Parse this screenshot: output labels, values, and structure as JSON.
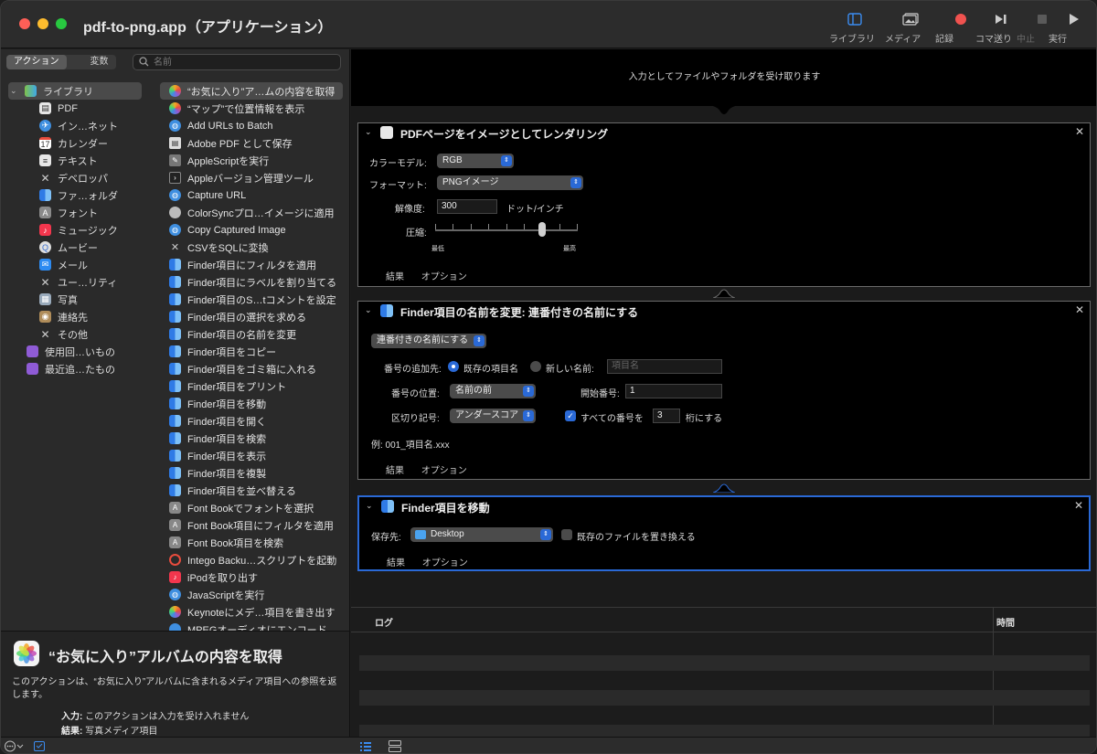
{
  "window": {
    "title": "pdf-to-png.app（アプリケーション）"
  },
  "toolbar": {
    "library": "ライブラリ",
    "media": "メディア",
    "record": "記録",
    "step": "コマ送り",
    "stop": "中止",
    "run": "実行"
  },
  "leftpane": {
    "tab_actions": "アクション",
    "tab_variables": "変数",
    "search_placeholder": "名前"
  },
  "categories": [
    {
      "label": "ライブラリ",
      "icon": "library-icon"
    },
    {
      "label": "PDF",
      "icon": "pdf-icon"
    },
    {
      "label": "イン…ネット",
      "icon": "internet-icon"
    },
    {
      "label": "カレンダー",
      "icon": "calendar-icon"
    },
    {
      "label": "テキスト",
      "icon": "text-icon"
    },
    {
      "label": "デベロッパ",
      "icon": "developer-icon"
    },
    {
      "label": "ファ…ォルダ",
      "icon": "finder-icon"
    },
    {
      "label": "フォント",
      "icon": "font-icon"
    },
    {
      "label": "ミュージック",
      "icon": "music-icon"
    },
    {
      "label": "ムービー",
      "icon": "movie-icon"
    },
    {
      "label": "メール",
      "icon": "mail-icon"
    },
    {
      "label": "ユー…リティ",
      "icon": "utility-icon"
    },
    {
      "label": "写真",
      "icon": "photos-icon"
    },
    {
      "label": "連絡先",
      "icon": "contacts-icon"
    },
    {
      "label": "その他",
      "icon": "other-icon"
    },
    {
      "label": "使用回…いもの",
      "icon": "smart-folder-icon"
    },
    {
      "label": "最近追…たもの",
      "icon": "smart-folder-icon"
    }
  ],
  "actions": [
    "“お気に入り”ア…ムの内容を取得",
    "“マップ”で位置情報を表示",
    "Add URLs to Batch",
    "Adobe PDF として保存",
    "AppleScriptを実行",
    "Appleバージョン管理ツール",
    "Capture URL",
    "ColorSyncプロ…イメージに適用",
    "Copy Captured Image",
    "CSVをSQLに変換",
    "Finder項目にフィルタを適用",
    "Finder項目にラベルを割り当てる",
    "Finder項目のS…tコメントを設定",
    "Finder項目の選択を求める",
    "Finder項目の名前を変更",
    "Finder項目をコピー",
    "Finder項目をゴミ箱に入れる",
    "Finder項目をプリント",
    "Finder項目を移動",
    "Finder項目を開く",
    "Finder項目を検索",
    "Finder項目を表示",
    "Finder項目を複製",
    "Finder項目を並べ替える",
    "Font Bookでフォントを選択",
    "Font Book項目にフィルタを適用",
    "Font Book項目を検索",
    "Intego Backu…スクリプトを起動",
    "iPodを取り出す",
    "JavaScriptを実行",
    "Keynoteにメデ…項目を書き出す",
    "MPEGオーディオにエンコード"
  ],
  "description": {
    "title": "“お気に入り”アルバムの内容を取得",
    "text": "このアクションは、“お気に入り”アルバムに含まれるメディア項目への参照を返します。",
    "input_label": "入力:",
    "input_value": "このアクションは入力を受け入れません",
    "result_label": "結果:",
    "result_value": "写真メディア項目"
  },
  "workflow": {
    "input_note": "入力としてファイルやフォルダを受け取ります",
    "card1": {
      "title": "PDFページをイメージとしてレンダリング",
      "color_model_label": "カラーモデル:",
      "color_model_value": "RGB",
      "format_label": "フォーマット:",
      "format_value": "PNGイメージ",
      "resolution_label": "解像度:",
      "resolution_value": "300",
      "resolution_unit": "ドット/インチ",
      "compression_label": "圧縮:",
      "min_label": "最低",
      "max_label": "最高",
      "compression_level": 0.75,
      "result": "結果",
      "options": "オプション"
    },
    "card2": {
      "title": "Finder項目の名前を変更: 連番付きの名前にする",
      "mode_value": "連番付きの名前にする",
      "add_number_to_label": "番号の追加先:",
      "existing_name": "既存の項目名",
      "new_name": "新しい名前:",
      "new_name_placeholder": "項目名",
      "position_label": "番号の位置:",
      "position_value": "名前の前",
      "start_label": "開始番号:",
      "start_value": "1",
      "separator_label": "区切り記号:",
      "separator_value": "アンダースコア",
      "all_numbers_label": "すべての番号を",
      "digits_value": "3",
      "digits_suffix": "桁にする",
      "example": "例:  001_項目名.xxx",
      "result": "結果",
      "options": "オプション"
    },
    "card3": {
      "title": "Finder項目を移動",
      "dest_label": "保存先:",
      "dest_value": "Desktop",
      "replace_label": "既存のファイルを置き換える",
      "result": "結果",
      "options": "オプション"
    }
  },
  "log": {
    "col_log": "ログ",
    "col_time": "時間"
  },
  "colors": {
    "accent": "#2a69d6",
    "close_red": "#fe5f57"
  }
}
